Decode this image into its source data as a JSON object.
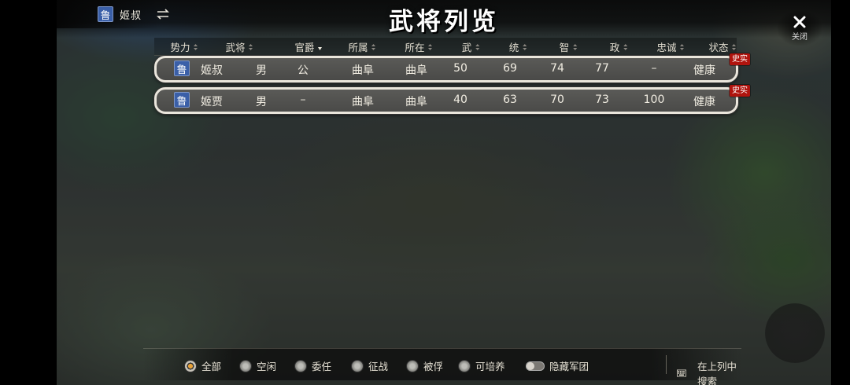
{
  "faction": {
    "seal": "鲁",
    "ruler": "姬叔"
  },
  "title": "武将列览",
  "close_label": "关闭",
  "columns": [
    "势力",
    "武将",
    "官爵",
    "所属",
    "所在",
    "武",
    "统",
    "智",
    "政",
    "忠诚",
    "状态"
  ],
  "rows": [
    {
      "seal": "鲁",
      "name": "姬叔",
      "gender": "男",
      "rank": "公",
      "affiliation": "曲阜",
      "location": "曲阜",
      "war": "50",
      "lead": "69",
      "intel": "74",
      "pol": "77",
      "loyalty": "–",
      "status": "健康",
      "badge": "史实"
    },
    {
      "seal": "鲁",
      "name": "姬贾",
      "gender": "男",
      "rank": "–",
      "affiliation": "曲阜",
      "location": "曲阜",
      "war": "40",
      "lead": "63",
      "intel": "70",
      "pol": "73",
      "loyalty": "100",
      "status": "健康",
      "badge": "史实"
    }
  ],
  "filters": [
    {
      "label": "全部",
      "selected": true
    },
    {
      "label": "空闲",
      "selected": false
    },
    {
      "label": "委任",
      "selected": false
    },
    {
      "label": "征战",
      "selected": false
    },
    {
      "label": "被俘",
      "selected": false
    },
    {
      "label": "可培养",
      "selected": false
    }
  ],
  "hide_army_label": "隐藏军团",
  "search_label": "在上列中搜索",
  "colors": {
    "seal": "#3a5fa8",
    "badge": "#b0140e",
    "radio_selected": "#e7a23a"
  }
}
